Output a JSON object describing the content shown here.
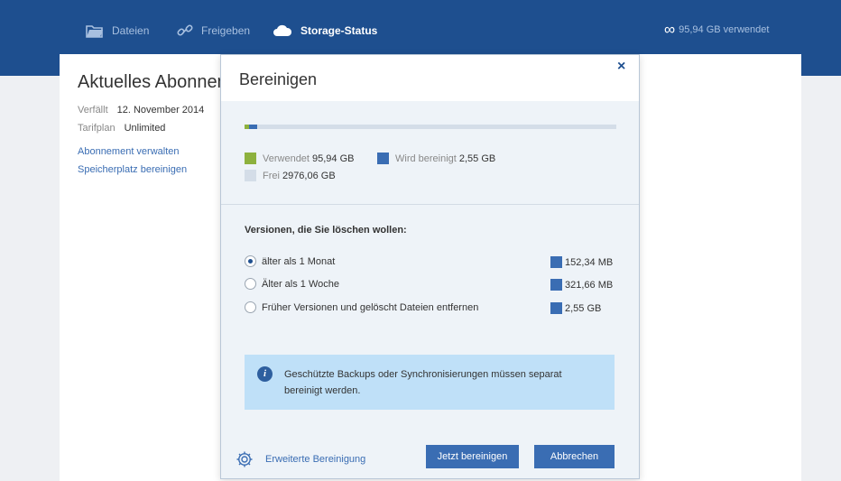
{
  "nav": {
    "files_label": "Dateien",
    "share_label": "Freigeben",
    "storage_label": "Storage-Status",
    "usage_text": "95,94 GB verwendet"
  },
  "subscription": {
    "title": "Aktuelles Abonnement",
    "expires_key": "Verfällt",
    "expires_value": "12. November 2014",
    "plan_key": "Tarifplan",
    "plan_value": "Unlimited",
    "manage_link": "Abonnement verwalten",
    "cleanup_link": "Speicherplatz bereinigen"
  },
  "dialog": {
    "title": "Bereinigen",
    "close_glyph": "×",
    "storage_bar": {
      "used_fraction": 0.032,
      "cleanup_fraction": 0.001
    },
    "legend": {
      "used_label": "Verwendet",
      "used_value": "95,94 GB",
      "cleanup_label": "Wird bereinigt",
      "cleanup_value": "2,55 GB",
      "free_label": "Frei",
      "free_value": "2976,06 GB"
    },
    "versions_title": "Versionen, die Sie löschen wollen:",
    "options": [
      {
        "label": "älter als 1 Monat",
        "size": "152,34 MB",
        "checked": true
      },
      {
        "label": "Älter als 1 Woche",
        "size": "321,66 MB",
        "checked": false
      },
      {
        "label": "Früher Versionen und gelöscht Dateien entfernen",
        "size": "2,55 GB",
        "checked": false
      }
    ],
    "note_text": "Geschützte Backups oder Synchronisierungen müssen separat bereinigt werden.",
    "advanced_label": "Erweiterte Bereinigung",
    "clean_now_label": "Jetzt bereinigen",
    "cancel_label": "Abbrechen"
  },
  "colors": {
    "topbar": "#1e4f8f",
    "used": "#8db13e",
    "cleanup": "#3a6db3",
    "free": "#d4dde8",
    "note_bg": "#bfe0f8",
    "button": "#3a6db3"
  },
  "icons": [
    "folder-icon",
    "link-icon",
    "cloud-icon",
    "infinity-icon",
    "close-icon",
    "info-icon",
    "gear-icon"
  ]
}
